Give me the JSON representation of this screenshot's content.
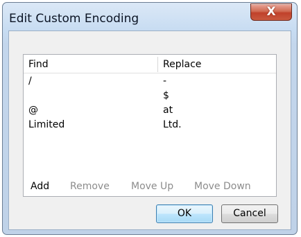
{
  "window": {
    "title": "Edit Custom Encoding",
    "close_label": "X"
  },
  "table": {
    "headers": {
      "find": "Find",
      "replace": "Replace"
    },
    "rows": [
      {
        "find": "/",
        "replace": "-"
      },
      {
        "find": "",
        "replace": "$"
      },
      {
        "find": "@",
        "replace": "at"
      },
      {
        "find": "Limited",
        "replace": "Ltd."
      }
    ]
  },
  "actions": {
    "add": "Add",
    "remove": "Remove",
    "move_up": "Move Up",
    "move_down": "Move Down"
  },
  "buttons": {
    "ok": "OK",
    "cancel": "Cancel"
  },
  "colors": {
    "disabled_text": "#8c8c8c",
    "default_button_border": "#3c7fb1",
    "close_button": "#c9593f"
  }
}
